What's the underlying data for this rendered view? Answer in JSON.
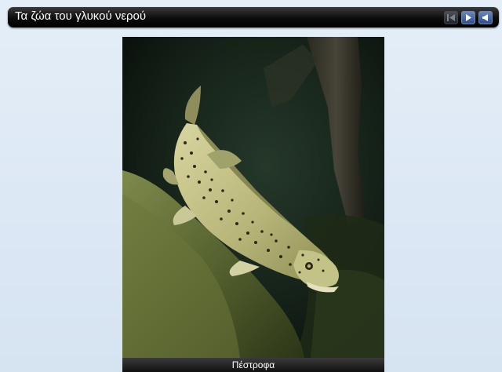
{
  "window": {
    "title": "Τα ζώα του γλυκού νερού"
  },
  "navigation": {
    "prev_icon": "skip-back-icon",
    "play_icon": "play-icon",
    "sound_icon": "speaker-icon"
  },
  "slide": {
    "image_name": "trout-photo",
    "caption": "Πέστροφα"
  }
}
